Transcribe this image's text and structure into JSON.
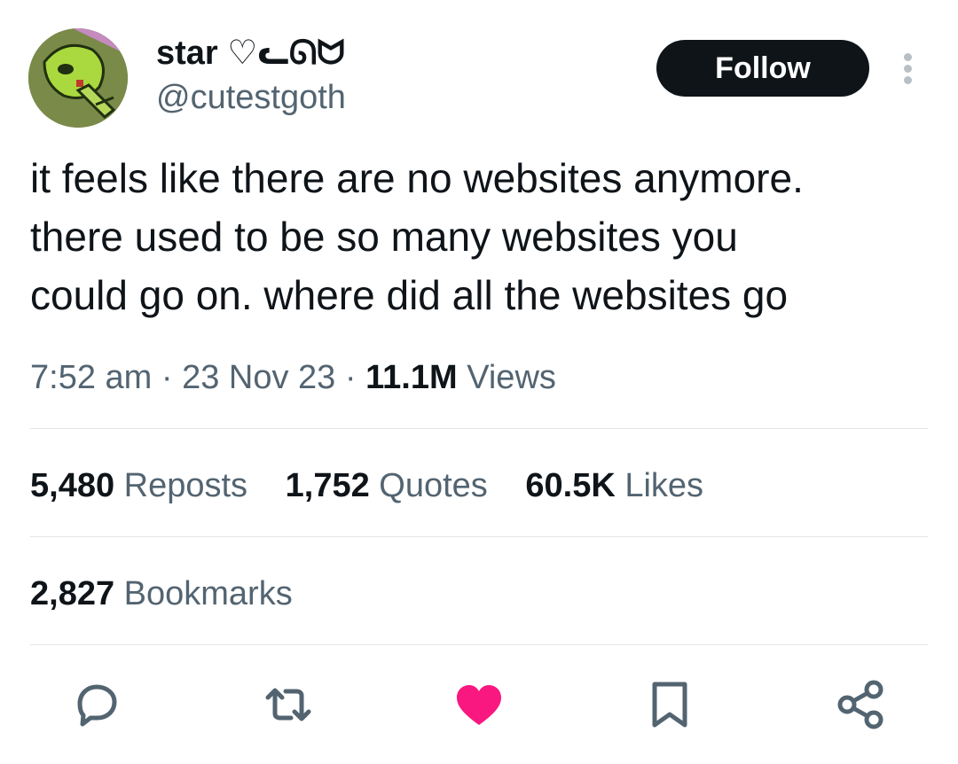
{
  "user": {
    "display_name": "star ♡ᓚᘏᗢ",
    "handle": "@cutestgoth",
    "avatar_icon": "cartoon-robot-avatar"
  },
  "follow_label": "Follow",
  "more_icon": "more-vertical-icon",
  "tweet": {
    "text": "it feels like there are no websites anymore.\nthere used to be so many websites you\ncould go on. where did all the websites go"
  },
  "meta": {
    "time": "7:52 am",
    "date": "23 Nov 23",
    "views_count": "11.1M",
    "views_label": "Views",
    "separator": "·"
  },
  "stats": {
    "reposts": {
      "count": "5,480",
      "label": "Reposts"
    },
    "quotes": {
      "count": "1,752",
      "label": "Quotes"
    },
    "likes": {
      "count": "60.5K",
      "label": "Likes"
    },
    "bookmarks": {
      "count": "2,827",
      "label": "Bookmarks"
    }
  },
  "actions": [
    {
      "icon": "reply-icon"
    },
    {
      "icon": "repost-icon"
    },
    {
      "icon": "like-icon-filled"
    },
    {
      "icon": "bookmark-icon"
    },
    {
      "icon": "share-icon"
    }
  ],
  "colors": {
    "text": "#0f1419",
    "secondary": "#536471",
    "like": "#f91880",
    "button_bg": "#0f1419",
    "divider": "#e1e6ea"
  }
}
